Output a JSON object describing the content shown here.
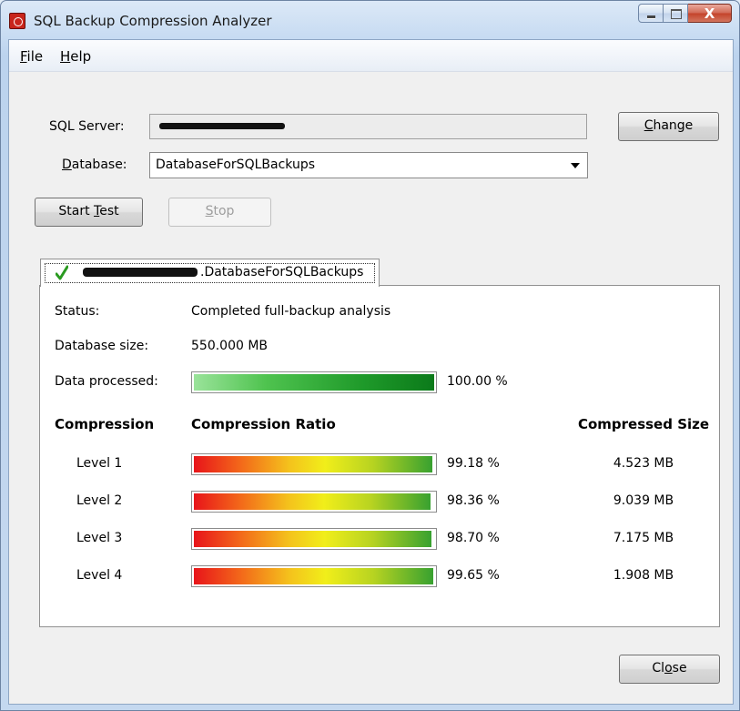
{
  "window": {
    "title": "SQL Backup Compression Analyzer",
    "close_glyph": "X"
  },
  "menu": {
    "file": {
      "underline": "F",
      "rest": "ile"
    },
    "help": {
      "underline": "H",
      "rest": "elp"
    }
  },
  "form": {
    "server_label": "SQL Server:",
    "database_label_underline": "D",
    "database_label_rest": "atabase:",
    "database_value": "DatabaseForSQLBackups",
    "change_button": {
      "underline": "C",
      "rest": "hange"
    },
    "start_button": {
      "before": "Start ",
      "underline": "T",
      "after": "est"
    },
    "stop_button": {
      "underline": "S",
      "rest": "top"
    }
  },
  "tab": {
    "label_suffix": ".DatabaseForSQLBackups",
    "status_icon": "green-check-icon"
  },
  "panel": {
    "status_label": "Status:",
    "status_value": "Completed full-backup analysis",
    "dbsize_label": "Database size:",
    "dbsize_value": "550.000 MB",
    "processed_label": "Data processed:",
    "processed_value": "100.00 %",
    "processed_fraction": 1.0,
    "header_compression": "Compression",
    "header_ratio": "Compression Ratio",
    "header_size": "Compressed Size",
    "levels": [
      {
        "name": "Level 1",
        "ratio_text": "99.18 %",
        "ratio": 0.9918,
        "size": "4.523 MB"
      },
      {
        "name": "Level 2",
        "ratio_text": "98.36 %",
        "ratio": 0.9836,
        "size": "9.039 MB"
      },
      {
        "name": "Level 3",
        "ratio_text": "98.70 %",
        "ratio": 0.987,
        "size": "7.175 MB"
      },
      {
        "name": "Level 4",
        "ratio_text": "99.65 %",
        "ratio": 0.9965,
        "size": "1.908 MB"
      }
    ]
  },
  "footer": {
    "close_button": {
      "before": "Cl",
      "underline": "o",
      "after": "se"
    }
  },
  "colors": {
    "progress_green": "#0b7a1a",
    "ratio_start": "#e8141a",
    "ratio_mid": "#f1ee1a",
    "ratio_end": "#38a130"
  }
}
